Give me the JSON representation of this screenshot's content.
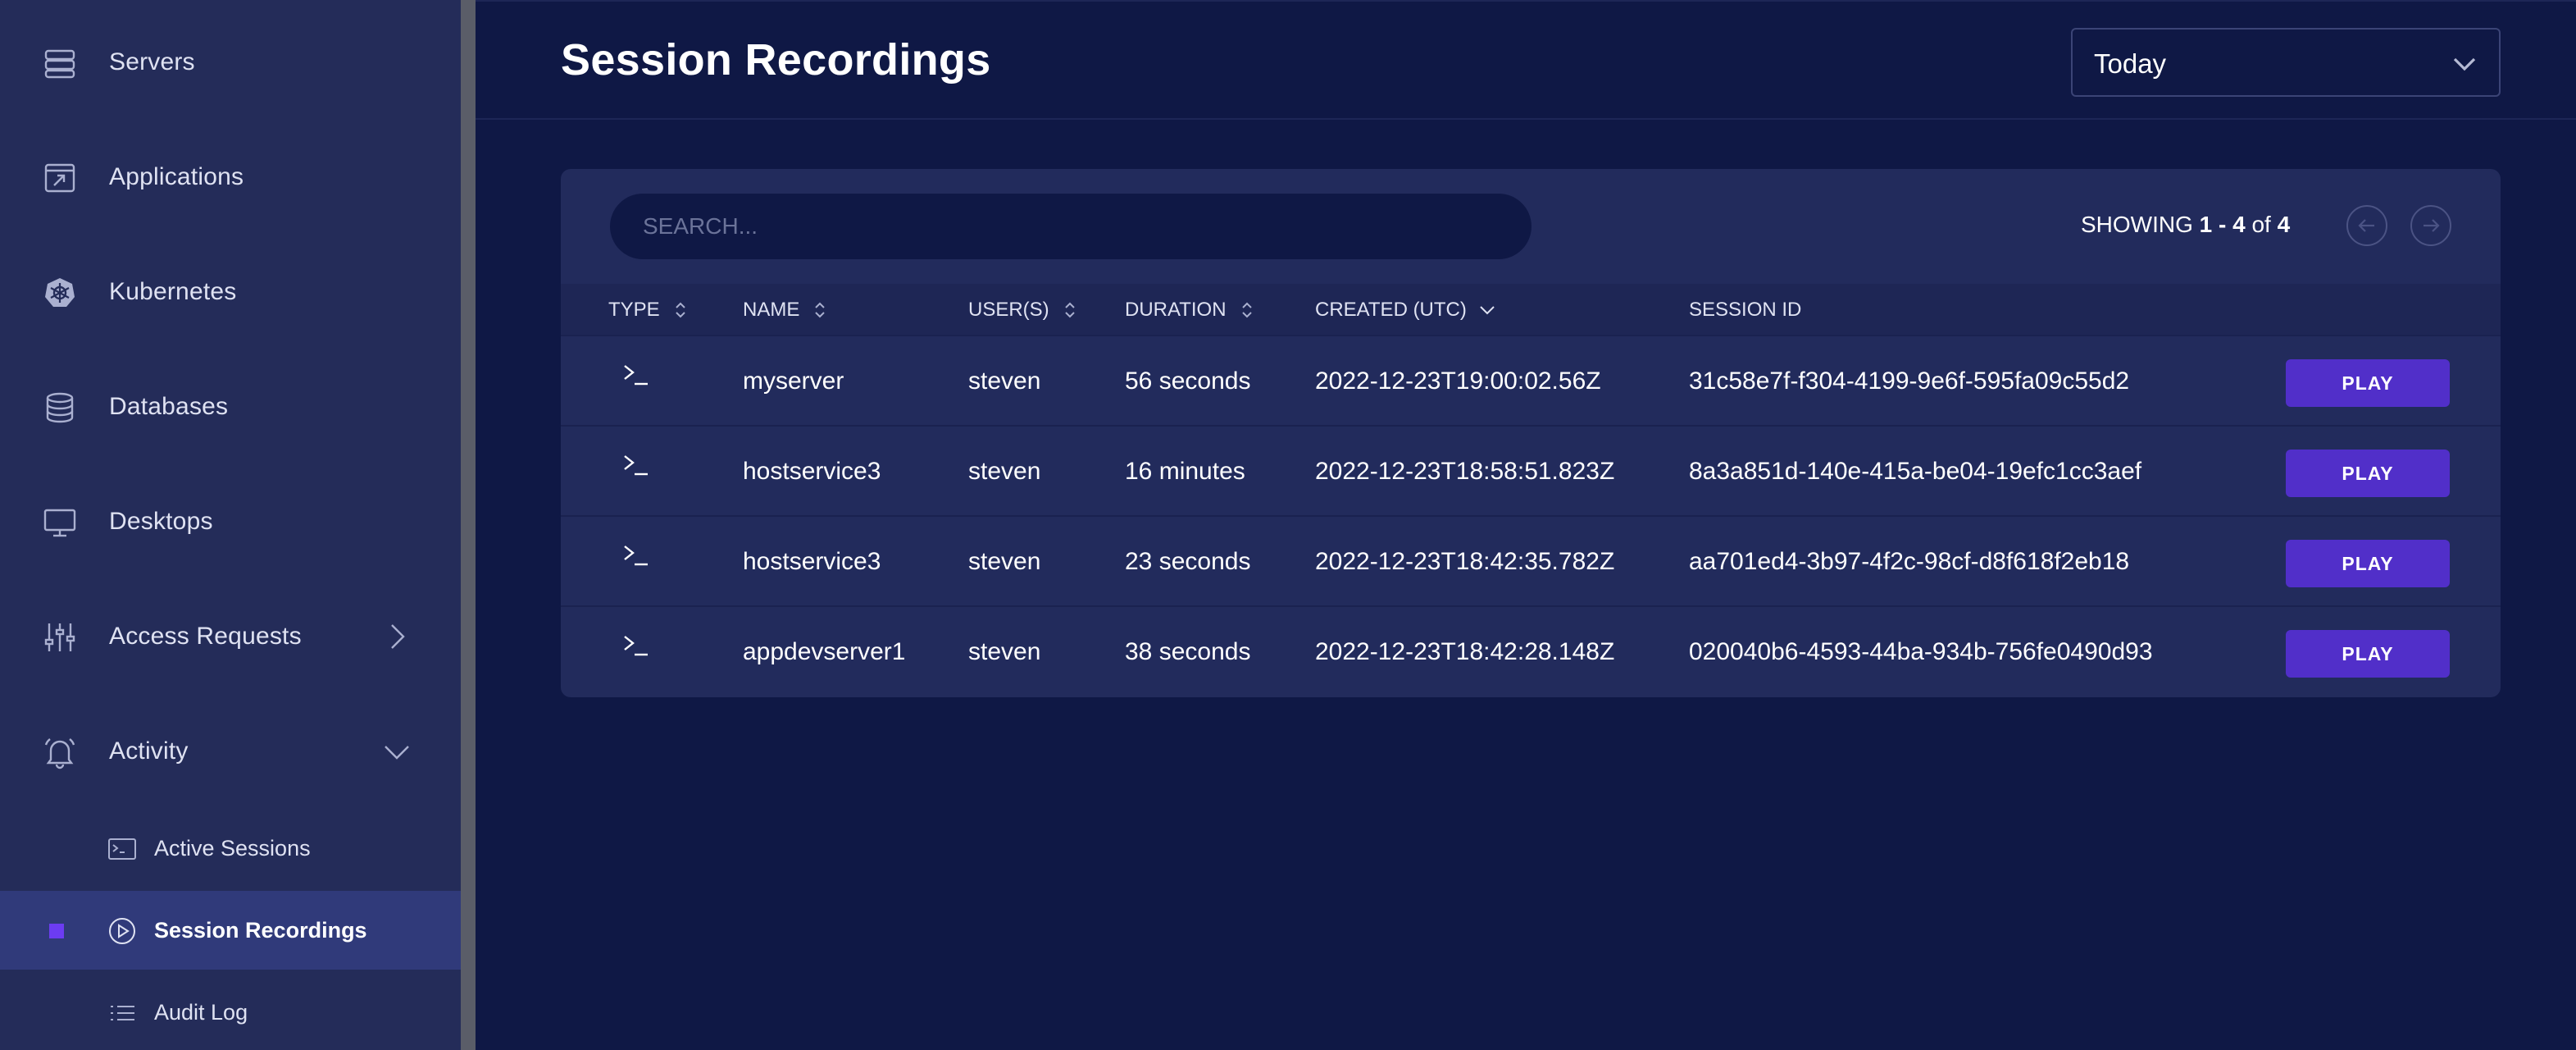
{
  "sidebar": {
    "items": [
      {
        "label": "Servers",
        "icon": "server-icon"
      },
      {
        "label": "Applications",
        "icon": "application-icon"
      },
      {
        "label": "Kubernetes",
        "icon": "kubernetes-icon"
      },
      {
        "label": "Databases",
        "icon": "database-icon"
      },
      {
        "label": "Desktops",
        "icon": "desktop-icon"
      },
      {
        "label": "Access Requests",
        "icon": "sliders-icon"
      },
      {
        "label": "Activity",
        "icon": "bell-icon"
      }
    ],
    "activity_subitems": [
      {
        "label": "Active Sessions",
        "icon": "terminal-icon"
      },
      {
        "label": "Session Recordings",
        "icon": "play-circle-icon",
        "active": true
      },
      {
        "label": "Audit Log",
        "icon": "list-icon"
      }
    ]
  },
  "header": {
    "title": "Session Recordings",
    "range_value": "Today"
  },
  "table": {
    "search_placeholder": "SEARCH...",
    "showing_prefix": "SHOWING ",
    "showing_range": "1 - 4",
    "showing_of": " of ",
    "showing_total": "4",
    "columns": {
      "type": "TYPE",
      "name": "NAME",
      "users": "USER(S)",
      "duration": "DURATION",
      "created": "CREATED (UTC)",
      "session_id": "SESSION ID"
    },
    "rows": [
      {
        "type_glyph": ">_",
        "name": "myserver",
        "user": "steven",
        "duration": "56 seconds",
        "created": "2022-12-23T19:00:02.56Z",
        "session_id": "31c58e7f-f304-4199-9e6f-595fa09c55d2",
        "action": "PLAY"
      },
      {
        "type_glyph": ">_",
        "name": "hostservice3",
        "user": "steven",
        "duration": "16 minutes",
        "created": "2022-12-23T18:58:51.823Z",
        "session_id": "8a3a851d-140e-415a-be04-19efc1cc3aef",
        "action": "PLAY"
      },
      {
        "type_glyph": ">_",
        "name": "hostservice3",
        "user": "steven",
        "duration": "23 seconds",
        "created": "2022-12-23T18:42:35.782Z",
        "session_id": "aa701ed4-3b97-4f2c-98cf-d8f618f2eb18",
        "action": "PLAY"
      },
      {
        "type_glyph": ">_",
        "name": "appdevserver1",
        "user": "steven",
        "duration": "38 seconds",
        "created": "2022-12-23T18:42:28.148Z",
        "session_id": "020040b6-4593-44ba-934b-756fe0490d93",
        "action": "PLAY"
      }
    ]
  },
  "colors": {
    "background": "#0f1845",
    "sidebar": "#242c59",
    "card": "#222b5c",
    "accent": "#512fc9",
    "active_marker": "#6c3cf2"
  }
}
